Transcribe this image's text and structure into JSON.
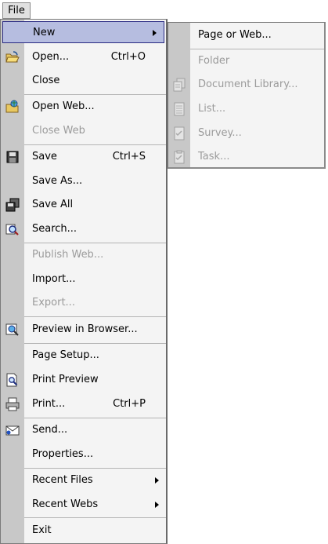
{
  "menubar": {
    "file_label": "File"
  },
  "file_menu": {
    "items": [
      {
        "label": "New",
        "shortcut": "",
        "submenu": true,
        "icon": "new-icon",
        "enabled": true
      },
      {
        "label": "Open...",
        "shortcut": "Ctrl+O",
        "icon": "open-folder-icon",
        "enabled": true
      },
      {
        "label": "Close",
        "shortcut": "",
        "enabled": true
      },
      {
        "label": "Open Web...",
        "shortcut": "",
        "icon": "open-web-icon",
        "enabled": true
      },
      {
        "label": "Close Web",
        "shortcut": "",
        "enabled": false
      },
      {
        "label": "Save",
        "shortcut": "Ctrl+S",
        "icon": "save-icon",
        "enabled": true
      },
      {
        "label": "Save As...",
        "shortcut": "",
        "enabled": true
      },
      {
        "label": "Save All",
        "shortcut": "",
        "icon": "save-all-icon",
        "enabled": true
      },
      {
        "label": "Search...",
        "shortcut": "",
        "icon": "search-icon",
        "enabled": true
      },
      {
        "label": "Publish Web...",
        "shortcut": "",
        "enabled": false
      },
      {
        "label": "Import...",
        "shortcut": "",
        "enabled": true
      },
      {
        "label": "Export...",
        "shortcut": "",
        "enabled": false
      },
      {
        "label": "Preview in Browser...",
        "shortcut": "",
        "icon": "preview-browser-icon",
        "enabled": true
      },
      {
        "label": "Page Setup...",
        "shortcut": "",
        "enabled": true
      },
      {
        "label": "Print Preview",
        "shortcut": "",
        "icon": "print-preview-icon",
        "enabled": true
      },
      {
        "label": "Print...",
        "shortcut": "Ctrl+P",
        "icon": "print-icon",
        "enabled": true
      },
      {
        "label": "Send...",
        "shortcut": "",
        "icon": "send-mail-icon",
        "enabled": true
      },
      {
        "label": "Properties...",
        "shortcut": "",
        "enabled": true
      },
      {
        "label": "Recent Files",
        "shortcut": "",
        "submenu": true,
        "enabled": true
      },
      {
        "label": "Recent Webs",
        "shortcut": "",
        "submenu": true,
        "enabled": true
      },
      {
        "label": "Exit",
        "shortcut": "",
        "enabled": true
      }
    ]
  },
  "new_submenu": {
    "items": [
      {
        "label": "Page or Web...",
        "enabled": true
      },
      {
        "label": "Folder",
        "enabled": false
      },
      {
        "label": "Document Library...",
        "icon": "document-library-icon",
        "enabled": false
      },
      {
        "label": "List...",
        "icon": "list-icon",
        "enabled": false
      },
      {
        "label": "Survey...",
        "icon": "survey-icon",
        "enabled": false
      },
      {
        "label": "Task...",
        "icon": "task-icon",
        "enabled": false
      }
    ]
  },
  "colors": {
    "highlight": "#b6bde0",
    "gutter": "#c8c8c8",
    "disabled_text": "#9b9b9b"
  }
}
